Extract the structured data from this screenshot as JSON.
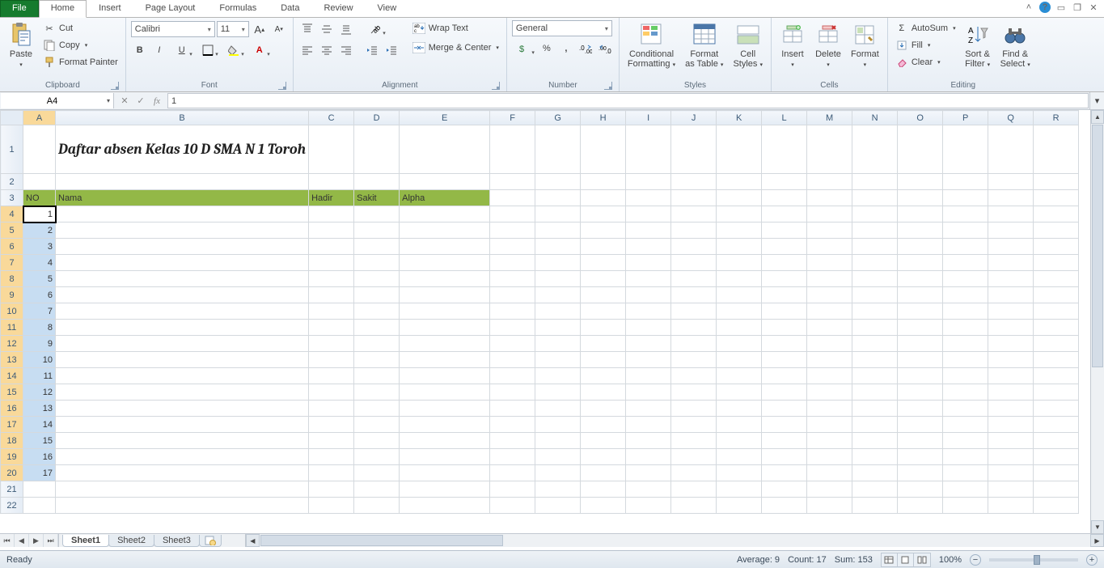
{
  "tabs": {
    "file": "File",
    "home": "Home",
    "insert": "Insert",
    "page_layout": "Page Layout",
    "formulas": "Formulas",
    "data": "Data",
    "review": "Review",
    "view": "View"
  },
  "clipboard": {
    "paste": "Paste",
    "cut": "Cut",
    "copy": "Copy",
    "painter": "Format Painter",
    "label": "Clipboard"
  },
  "font": {
    "name": "Calibri",
    "size": "11",
    "label": "Font"
  },
  "alignment": {
    "wrap": "Wrap Text",
    "merge": "Merge & Center",
    "label": "Alignment"
  },
  "number": {
    "format": "General",
    "label": "Number"
  },
  "styles": {
    "cond": "Conditional Formatting",
    "table": "Format as Table",
    "cell": "Cell Styles",
    "label": "Styles"
  },
  "cells": {
    "insert": "Insert",
    "delete": "Delete",
    "format": "Format",
    "label": "Cells"
  },
  "editing": {
    "sum": "AutoSum",
    "fill": "Fill",
    "clear": "Clear",
    "sort": "Sort & Filter",
    "find": "Find & Select",
    "label": "Editing"
  },
  "namebox": "A4",
  "formula": "1",
  "columns": [
    "A",
    "B",
    "C",
    "D",
    "E",
    "F",
    "G",
    "H",
    "I",
    "J",
    "K",
    "L",
    "M",
    "N",
    "O",
    "P",
    "Q",
    "R"
  ],
  "col_widths": {
    "A": 40,
    "B": 238,
    "C": 56,
    "D": 56,
    "E": 112,
    "default": 56
  },
  "row_count": 22,
  "tall_rows": [
    1
  ],
  "title_cell": {
    "row": 1,
    "col": "B",
    "text": "Daftar absen Kelas 10 D SMA N 1 Toroh"
  },
  "header_row": 3,
  "header_cols": [
    "A",
    "B",
    "C",
    "D",
    "E"
  ],
  "headers": {
    "A": "NO",
    "B": "Nama",
    "C": "Hadir",
    "D": "Sakit",
    "E": "Alpha"
  },
  "data_rows": [
    4,
    5,
    6,
    7,
    8,
    9,
    10,
    11,
    12,
    13,
    14,
    15,
    16,
    17,
    18,
    19,
    20
  ],
  "data_values": {
    "4": "1",
    "5": "2",
    "6": "3",
    "7": "4",
    "8": "5",
    "9": "6",
    "10": "7",
    "11": "8",
    "12": "9",
    "13": "10",
    "14": "11",
    "15": "12",
    "16": "13",
    "17": "14",
    "18": "15",
    "19": "16",
    "20": "17"
  },
  "active_cell": {
    "row": 4,
    "col": "A"
  },
  "selection": {
    "col": "A",
    "rows_from": 4,
    "rows_to": 20
  },
  "sheets": [
    "Sheet1",
    "Sheet2",
    "Sheet3"
  ],
  "active_sheet": 0,
  "status": {
    "ready": "Ready",
    "avg": "Average: 9",
    "count": "Count: 17",
    "sum": "Sum: 153",
    "zoom": "100%"
  }
}
